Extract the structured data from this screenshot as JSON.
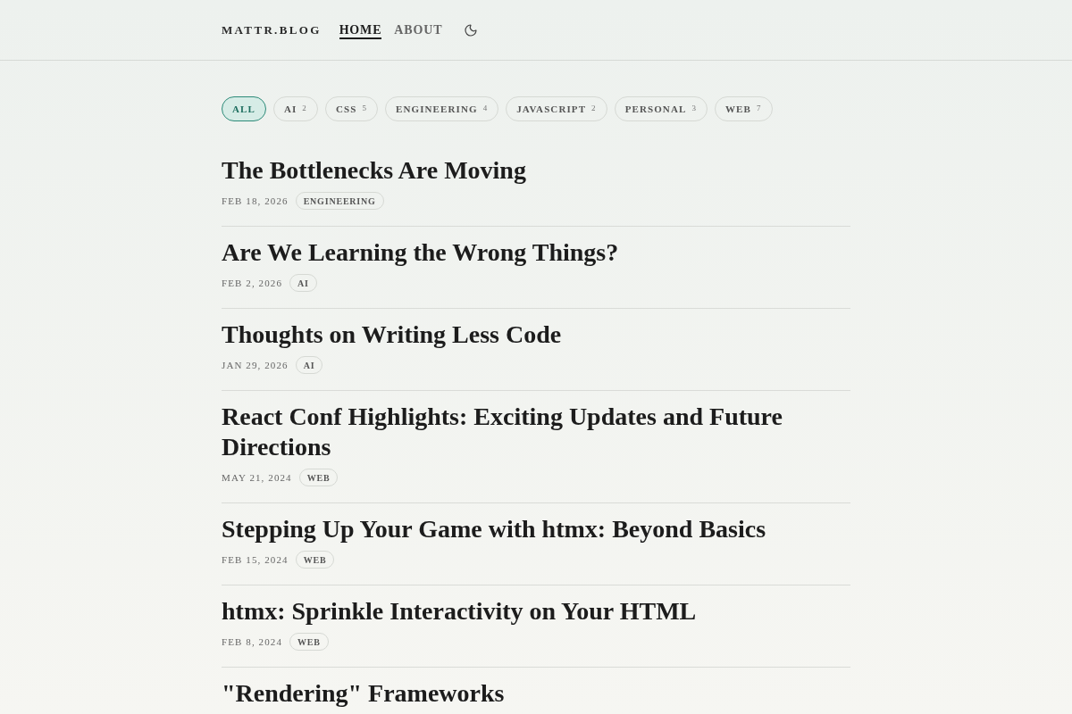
{
  "header": {
    "logo": "MATTR.BLOG",
    "nav": [
      {
        "label": "HOME",
        "selected": true
      },
      {
        "label": "ABOUT",
        "selected": false
      }
    ]
  },
  "filters": [
    {
      "label": "ALL",
      "selected": true
    },
    {
      "label": "AI",
      "count": "2",
      "selected": false
    },
    {
      "label": "CSS",
      "count": "5",
      "selected": false
    },
    {
      "label": "ENGINEERING",
      "count": "4",
      "selected": false
    },
    {
      "label": "JAVASCRIPT",
      "count": "2",
      "selected": false
    },
    {
      "label": "PERSONAL",
      "count": "3",
      "selected": false
    },
    {
      "label": "WEB",
      "count": "7",
      "selected": false
    }
  ],
  "posts": [
    {
      "title": "The Bottlenecks Are Moving",
      "date": "FEB 18, 2026",
      "tag": "ENGINEERING"
    },
    {
      "title": "Are We Learning the Wrong Things?",
      "date": "FEB 2, 2026",
      "tag": "AI"
    },
    {
      "title": "Thoughts on Writing Less Code",
      "date": "JAN 29, 2026",
      "tag": "AI"
    },
    {
      "title": "React Conf Highlights: Exciting Updates and Future Directions",
      "date": "MAY 21, 2024",
      "tag": "WEB"
    },
    {
      "title": "Stepping Up Your Game with htmx: Beyond Basics",
      "date": "FEB 15, 2024",
      "tag": "WEB"
    },
    {
      "title": "htmx: Sprinkle Interactivity on Your HTML",
      "date": "FEB 8, 2024",
      "tag": "WEB"
    },
    {
      "title": "\"Rendering\" Frameworks"
    }
  ]
}
